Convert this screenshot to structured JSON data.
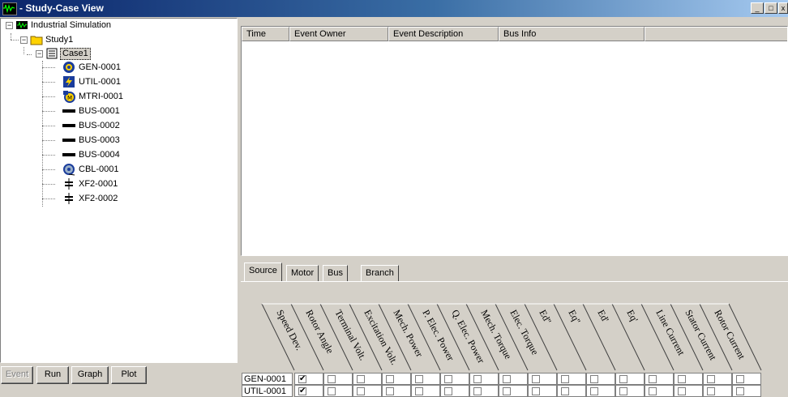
{
  "window": {
    "title": "- Study-Case View",
    "minimize": "_",
    "maximize": "□",
    "close": "x"
  },
  "tree": {
    "root": "Industrial Simulation",
    "study": "Study1",
    "case": "Case1",
    "items": [
      {
        "label": "GEN-0001",
        "icon": "generator-icon"
      },
      {
        "label": "UTIL-0001",
        "icon": "utility-icon"
      },
      {
        "label": "MTRI-0001",
        "icon": "induction-motor-icon"
      },
      {
        "label": "BUS-0001",
        "icon": "bus-icon"
      },
      {
        "label": "BUS-0002",
        "icon": "bus-icon"
      },
      {
        "label": "BUS-0003",
        "icon": "bus-icon"
      },
      {
        "label": "BUS-0004",
        "icon": "bus-icon"
      },
      {
        "label": "CBL-0001",
        "icon": "cable-icon"
      },
      {
        "label": "XF2-0001",
        "icon": "transformer-icon"
      },
      {
        "label": "XF2-0002",
        "icon": "transformer-icon"
      }
    ]
  },
  "buttons": {
    "event": "Event",
    "run": "Run",
    "graph": "Graph",
    "plot": "Plot"
  },
  "events_table": {
    "columns": [
      "Time",
      "Event Owner",
      "Event Description",
      "Bus Info",
      ""
    ]
  },
  "tabs": [
    "Source",
    "Motor",
    "Bus",
    "Branch"
  ],
  "active_tab": "Source",
  "plot_grid": {
    "columns": [
      "Speed Dev.",
      "Rotor Angle",
      "Terminal Volt.",
      "Excitation Volt.",
      "Mech. Power",
      "P. Elec. Power",
      "Q. Elec. Power",
      "Mech. Torque",
      "Elec. Torque",
      "Ed''",
      "Eq''",
      "Ed'",
      "Eq'",
      "Line Current",
      "Stator Current",
      "Rotor Current"
    ],
    "rows": [
      {
        "name": "GEN-0001",
        "checked": [
          true,
          false,
          false,
          false,
          false,
          false,
          false,
          false,
          false,
          false,
          false,
          false,
          false,
          false,
          false,
          false
        ]
      },
      {
        "name": "UTIL-0001",
        "checked": [
          true,
          false,
          false,
          false,
          false,
          false,
          false,
          false,
          false,
          false,
          false,
          false,
          false,
          false,
          false,
          false
        ]
      }
    ]
  },
  "colors": {
    "titlebar_start": "#0a246a",
    "titlebar_end": "#a6caf0",
    "face": "#d4d0c8",
    "folder": "#ffd200"
  }
}
